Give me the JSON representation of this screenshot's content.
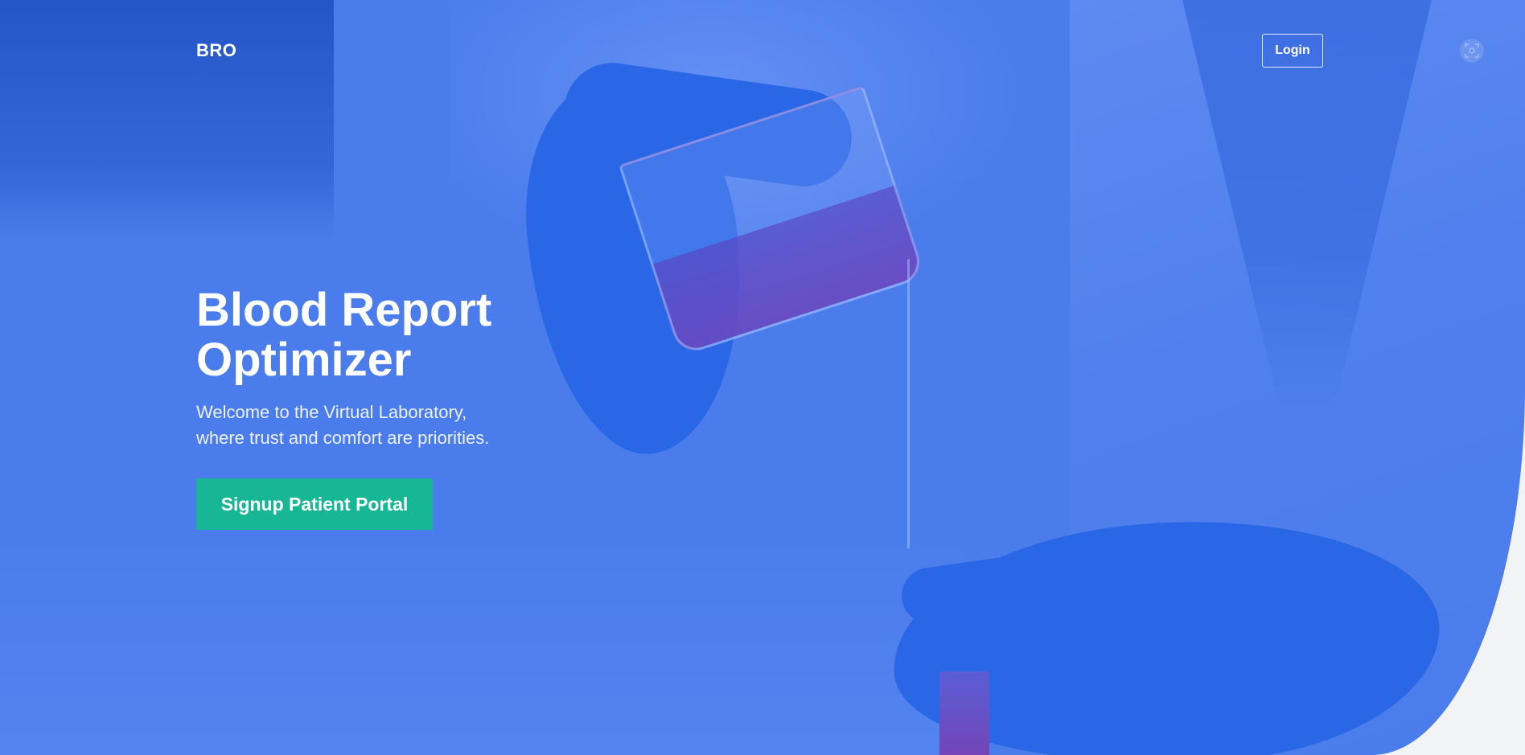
{
  "nav": {
    "brand": "BRO",
    "login_label": "Login",
    "scan_icon": "scan-icon"
  },
  "hero": {
    "title_line1": "Blood Report",
    "title_line2": "Optimizer",
    "subtitle_line1": "Welcome to the Virtual Laboratory,",
    "subtitle_line2": "where trust and comfort are priorities.",
    "cta_label": "Signup Patient Portal"
  },
  "colors": {
    "overlay_blue": "#4a7cec",
    "cta_green": "#17b795",
    "text_white": "#ffffff"
  }
}
